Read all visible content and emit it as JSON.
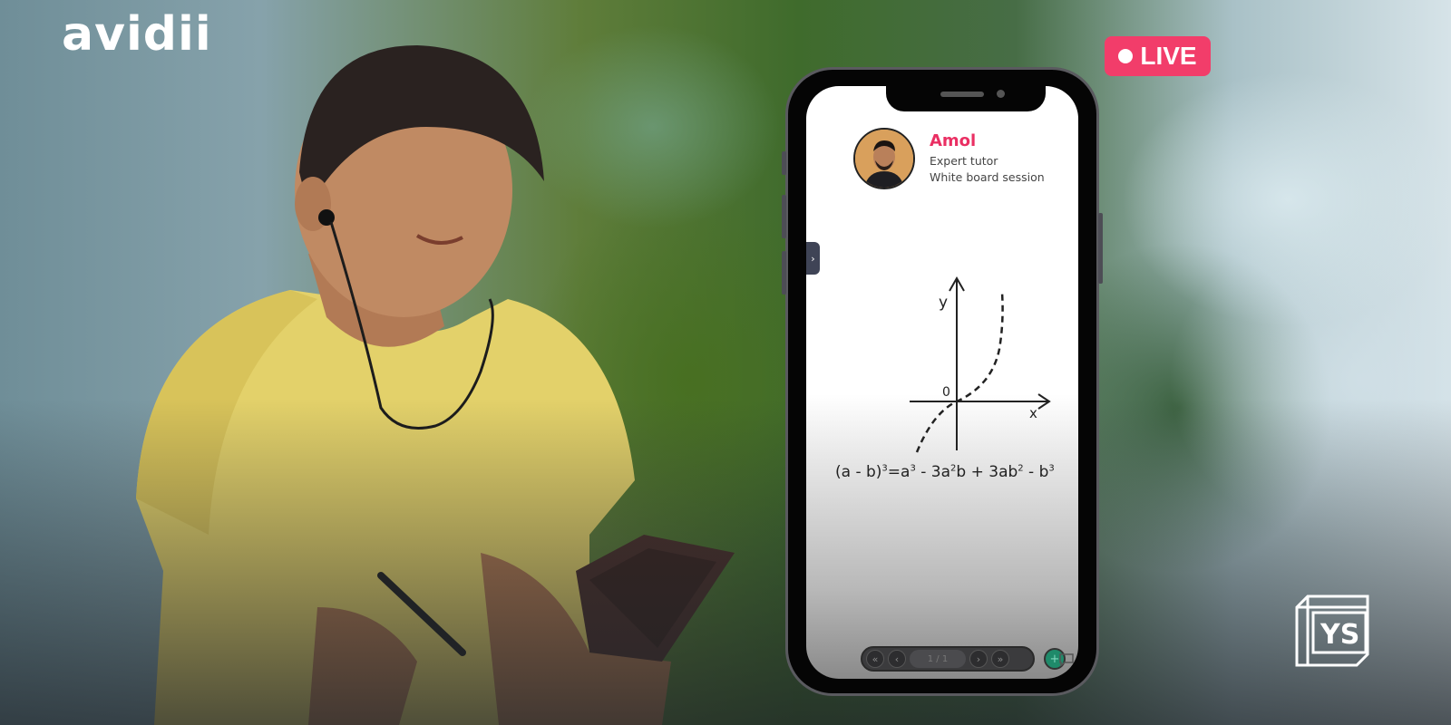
{
  "brand": {
    "logo_text": "avidii"
  },
  "live_badge": {
    "label": "LIVE",
    "color": "#f23d6a"
  },
  "phone": {
    "tutor": {
      "name": "Amol",
      "role": "Expert tutor",
      "session": "White board session",
      "name_color": "#ea2f63"
    },
    "whiteboard": {
      "axis_y_label": "y",
      "axis_x_label": "x",
      "origin_label": "0",
      "formula_parts": {
        "lhs": "(a - b)",
        "lhs_exp": "3",
        "eq": "=",
        "t1": "a",
        "t1_exp": "3",
        "t2": " - 3a",
        "t2_exp": "2",
        "t2b": "b + 3ab",
        "t3_exp": "2",
        "t4": " - b",
        "t4_exp": "3"
      }
    },
    "toolbar": {
      "first_icon": "first-page-icon",
      "prev_icon": "prev-page-icon",
      "page_indicator": "1 / 1",
      "next_icon": "next-page-icon",
      "last_icon": "last-page-icon",
      "add_icon": "add-page-icon",
      "chat_icon": "chat-icon"
    }
  },
  "watermark": {
    "text": "YS"
  }
}
